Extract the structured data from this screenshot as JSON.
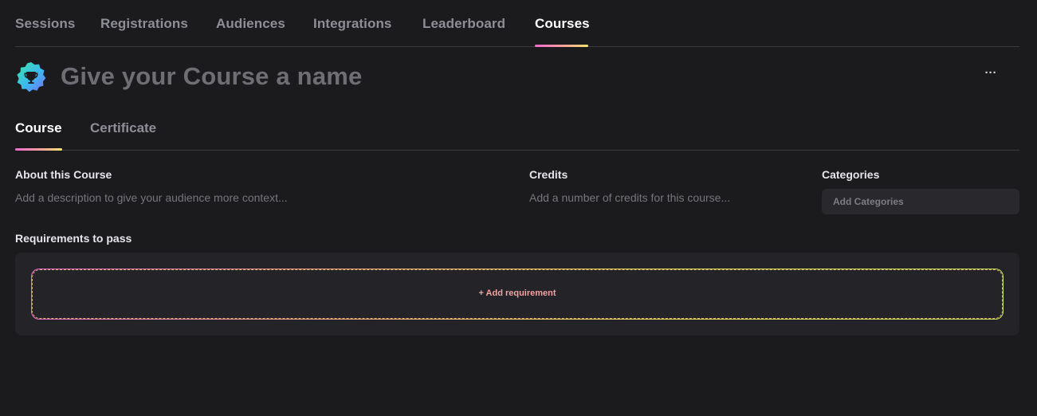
{
  "topnav": {
    "tabs": [
      {
        "label": "Sessions",
        "active": false
      },
      {
        "label": "Registrations",
        "active": false
      },
      {
        "label": "Audiences",
        "active": false
      },
      {
        "label": "Integrations",
        "active": false
      },
      {
        "label": "Leaderboard",
        "active": false
      },
      {
        "label": "Courses",
        "active": true
      }
    ]
  },
  "header": {
    "badge_icon": "trophy-icon",
    "name_placeholder": "Give your Course a name",
    "name_value": "",
    "more_label": "···"
  },
  "subnav": {
    "tabs": [
      {
        "label": "Course",
        "active": true
      },
      {
        "label": "Certificate",
        "active": false
      }
    ]
  },
  "about": {
    "label": "About this Course",
    "placeholder": "Add a description to give your audience more context...",
    "value": ""
  },
  "credits": {
    "label": "Credits",
    "placeholder": "Add a number of credits for this course...",
    "value": ""
  },
  "categories": {
    "label": "Categories",
    "placeholder": "Add Categories"
  },
  "requirements": {
    "label": "Requirements to pass",
    "add_label": "+ Add requirement"
  },
  "colors": {
    "background": "#1b1b1e",
    "panel": "#242328",
    "accent_gradient": [
      "#f06ad0",
      "#f8a39a",
      "#f5e36c"
    ],
    "badge_gradient": [
      "#3ee6a8",
      "#3bb8f0",
      "#7d6cf5"
    ]
  }
}
